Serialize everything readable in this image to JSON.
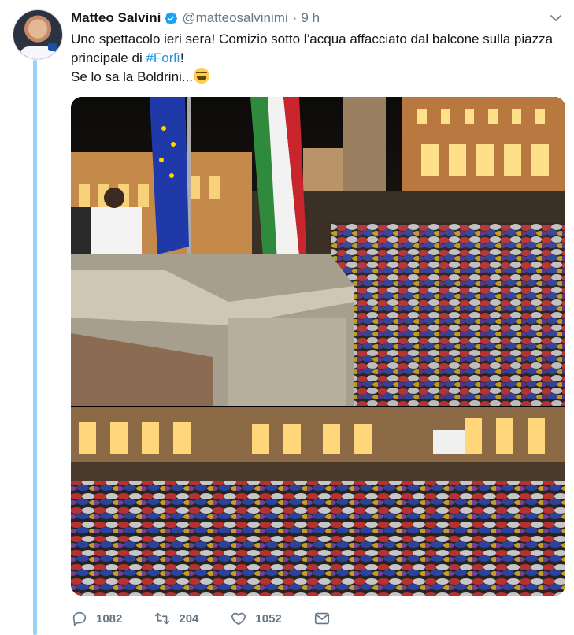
{
  "author": {
    "name": "Matteo Salvini",
    "handle": "@matteosalvinimi",
    "separator": "·",
    "time": "9 h",
    "verified": true,
    "verified_icon": "verified-badge-icon"
  },
  "tweet": {
    "line1": "Uno spettacolo ieri sera! Comizio sotto l’acqua affacciato dal balcone sulla piazza principale di ",
    "hashtag": "#Forlì",
    "line1_end": "!",
    "line2": "Se lo sa la Boldrini...",
    "emoji": "rolling-on-floor-laughing-emoji"
  },
  "media": {
    "photos": [
      "balcony-rally-photo",
      "square-crowd-photo"
    ]
  },
  "actions": {
    "replies": "1082",
    "retweets": "204",
    "likes": "1052",
    "reply_icon": "reply-icon",
    "retweet_icon": "retweet-icon",
    "like_icon": "heart-icon",
    "dm_icon": "mail-icon"
  },
  "colors": {
    "accent": "#1b95e0",
    "secondary_text": "#657786",
    "thread_line": "#98d2f5"
  }
}
